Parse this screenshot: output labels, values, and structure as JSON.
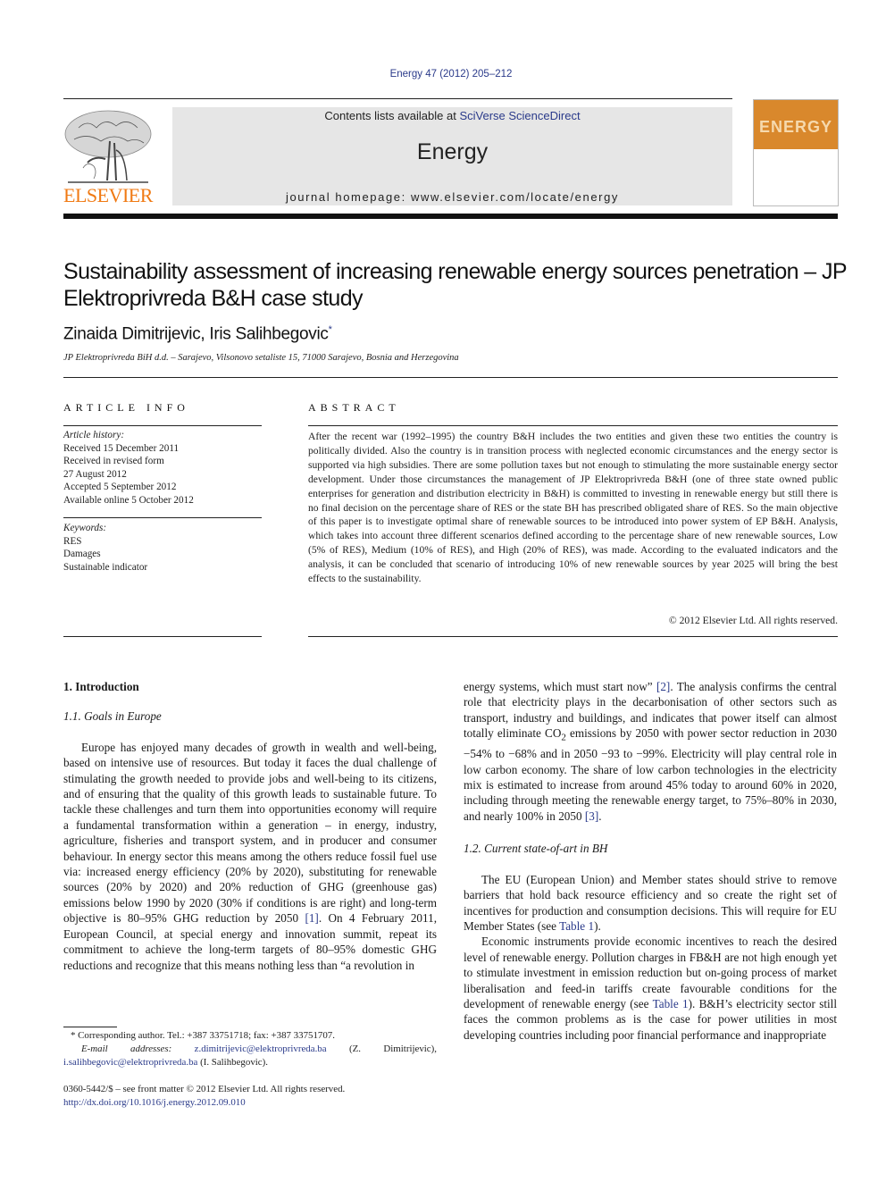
{
  "header": {
    "journal_ref": "Energy 47 (2012) 205–212",
    "contents_prefix": "Contents lists available at ",
    "contents_link": "SciVerse ScienceDirect",
    "journal_title": "Energy",
    "homepage": "journal homepage: www.elsevier.com/locate/energy",
    "publisher_logo_text": "ELSEVIER",
    "cover_word": "ENERGY",
    "colors": {
      "publisher_orange": "#f07a14",
      "cover_orange": "#d9882c",
      "link_blue": "#2a3a8a",
      "banner_gray": "#e6e6e6"
    }
  },
  "article": {
    "title": "Sustainability assessment of increasing renewable energy sources penetration – JP Elektroprivreda B&H case study",
    "authors": "Zinaida Dimitrijevic, Iris Salihbegovic",
    "corresponding_mark": "*",
    "affiliation": "JP Elektroprivreda BiH d.d. – Sarajevo, Vilsonovo setaliste 15, 71000 Sarajevo, Bosnia and Herzegovina"
  },
  "article_info": {
    "heading": "ARTICLE INFO",
    "history_label": "Article history:",
    "history": [
      "Received 15 December 2011",
      "Received in revised form",
      "27 August 2012",
      "Accepted 5 September 2012",
      "Available online 5 October 2012"
    ],
    "keywords_label": "Keywords:",
    "keywords": [
      "RES",
      "Damages",
      "Sustainable indicator"
    ]
  },
  "abstract": {
    "heading": "ABSTRACT",
    "text": "After the recent war (1992–1995) the country B&H includes the two entities and given these two entities the country is politically divided. Also the country is in transition process with neglected economic circumstances and the energy sector is supported via high subsidies. There are some pollution taxes but not enough to stimulating the more sustainable energy sector development. Under those circumstances the management of JP Elektroprivreda B&H (one of three state owned public enterprises for generation and distribution electricity in B&H) is committed to investing in renewable energy but still there is no final decision on the percentage share of RES or the state BH has prescribed obligated share of RES. So the main objective of this paper is to investigate optimal share of renewable sources to be introduced into power system of EP B&H. Analysis, which takes into account three different scenarios defined according to the percentage share of new renewable sources, Low (5% of RES), Medium (10% of RES), and High (20% of RES), was made. According to the evaluated indicators and the analysis, it can be concluded that scenario of introducing 10% of new renewable sources by year 2025 will bring the best effects to the sustainability.",
    "copyright": "© 2012 Elsevier Ltd. All rights reserved."
  },
  "body": {
    "section1_heading": "1.  Introduction",
    "subsection11_heading": "1.1.  Goals in Europe",
    "para1_a": "Europe has enjoyed many decades of growth in wealth and well-being, based on intensive use of resources. But today it faces the dual challenge of stimulating the growth needed to provide jobs and well-being to its citizens, and of ensuring that the quality of this growth leads to sustainable future. To tackle these challenges and turn them into opportunities economy will require a fundamental transformation within a generation – in energy, industry, agriculture, fisheries and transport system, and in producer and consumer behaviour. In energy sector this means among the others reduce fossil fuel use via: increased energy efficiency (20% by 2020), substituting for renewable sources (20% by 2020) and 20% reduction of GHG (greenhouse gas) emissions below 1990 by 2020 (30% if conditions is are right) and long-term objective is 80–95% GHG reduction by 2050 ",
    "ref1": "[1]",
    "para1_b": ". On 4 February 2011, European Council, at special energy and innovation summit, repeat its commitment to achieve the long-term targets of 80–95% domestic GHG reductions and recognize that this means nothing less than “a revolution in ",
    "para1_c": "energy systems, which must start now” ",
    "ref2": "[2]",
    "para1_d": ". The analysis confirms the central role that electricity plays in the decarbonisation of other sectors such as transport, industry and buildings, and indicates that power itself can almost totally eliminate CO",
    "co2_sub": "2",
    "para1_e": " emissions by 2050 with power sector reduction in 2030 −54% to −68% and in 2050 −93 to −99%. Electricity will play central role in low carbon economy. The share of low carbon technologies in the electricity mix is estimated to increase from around 45% today to around 60% in 2020, including through meeting the renewable energy target, to 75%–80% in 2030, and nearly 100% in 2050 ",
    "ref3": "[3]",
    "para1_f": ".",
    "subsection12_heading": "1.2.  Current state-of-art in BH",
    "para2_a": "The EU (European Union) and Member states should strive to remove barriers that hold back resource efficiency and so create the right set of incentives for production and consumption decisions. This will require for EU Member States (see ",
    "table1_ref": "Table 1",
    "para2_b": ").",
    "para3_a": "Economic instruments provide economic incentives to reach the desired level of renewable energy. Pollution charges in FB&H are not high enough yet to stimulate investment in emission reduction but on-going process of market liberalisation and feed-in tariffs create favourable conditions for the development of renewable energy (see ",
    "para3_b": "). B&H’s electricity sector still faces the common problems as is the case for power utilities in most developing countries including poor financial performance and inappropriate"
  },
  "footnotes": {
    "corresponding": "* Corresponding author. Tel.: +387 33751718; fax: +387 33751707.",
    "email_label": "E-mail addresses:",
    "email1": "z.dimitrijevic@elektroprivreda.ba",
    "email1_name": " (Z. Dimitrijevic), ",
    "email2": "i.salihbegovic@elektroprivreda.ba",
    "email2_name": " (I. Salihbegovic).",
    "front_matter": "0360-5442/$ – see front matter © 2012 Elsevier Ltd. All rights reserved.",
    "doi": "http://dx.doi.org/10.1016/j.energy.2012.09.010"
  }
}
